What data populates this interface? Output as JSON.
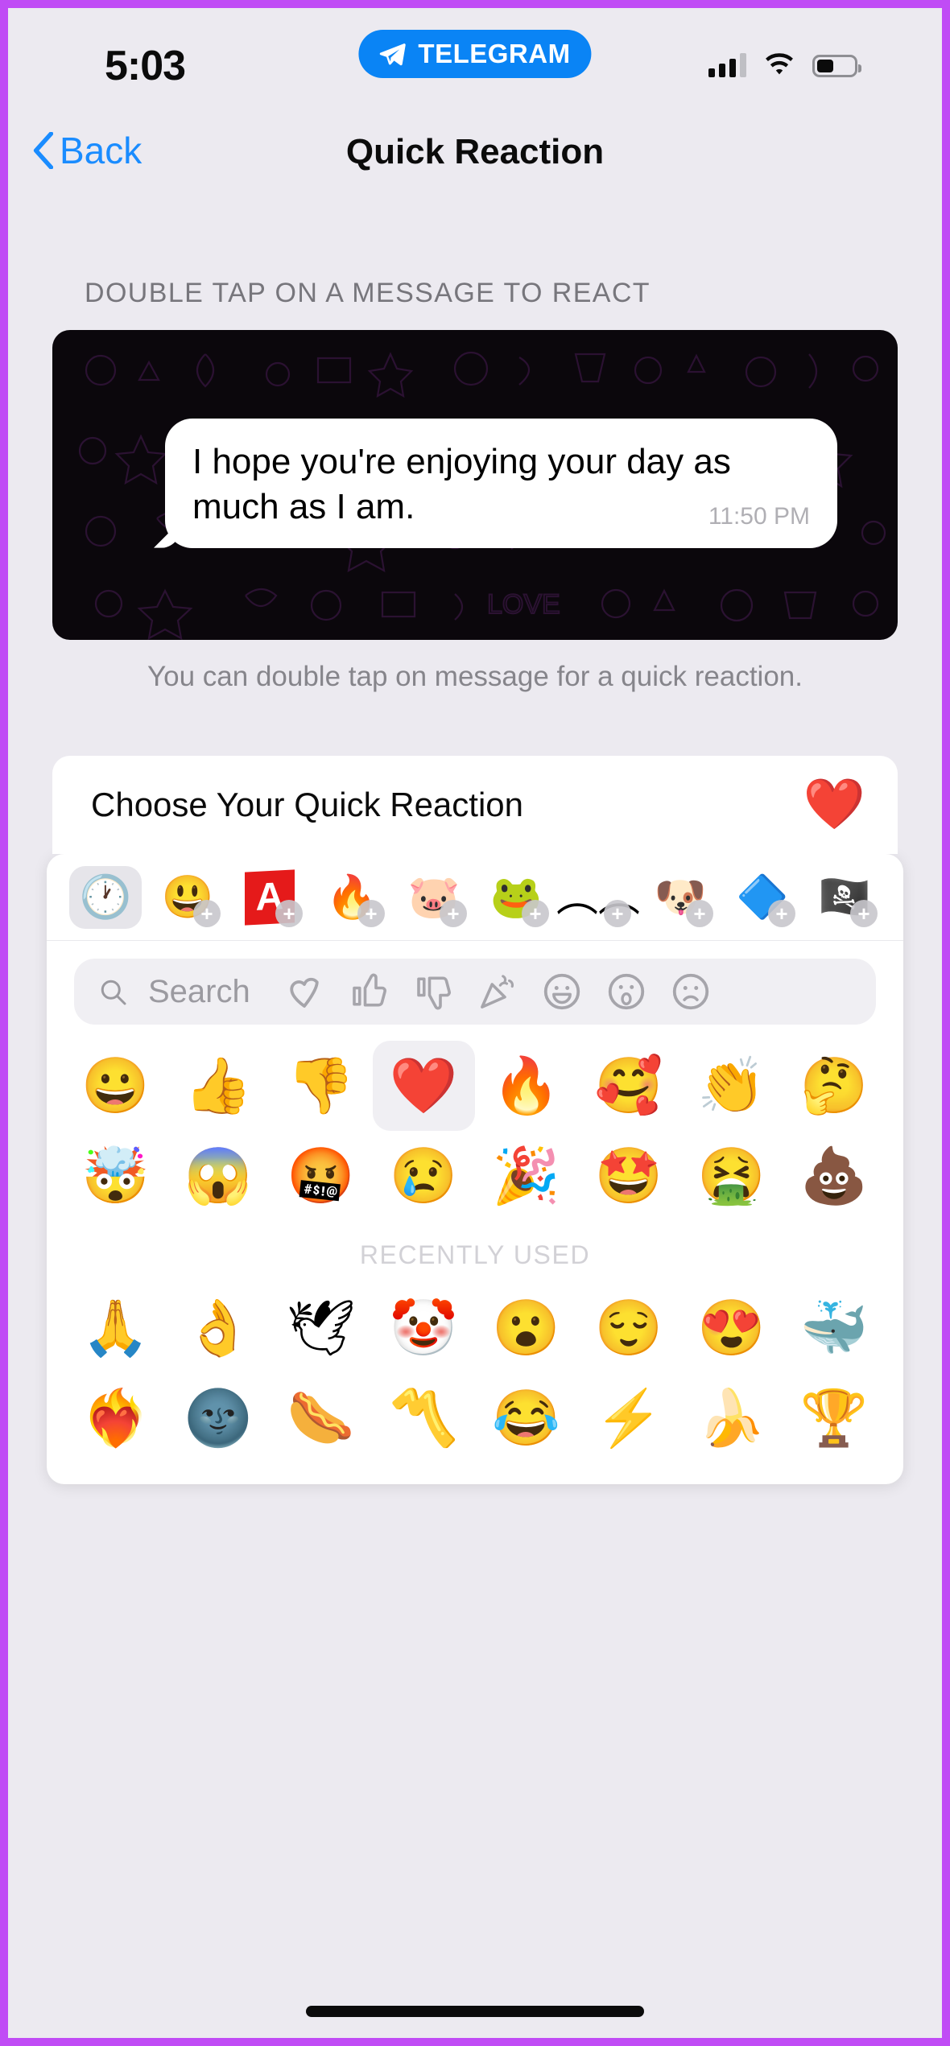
{
  "theme": {
    "accent_blue": "#1a8cff",
    "telegram_blue": "#0a84f5",
    "page_bg": "#eceaf0",
    "card_bg": "#ffffff",
    "border_purple": "#c04cf5"
  },
  "status_bar": {
    "time": "5:03",
    "badge_label": "TELEGRAM",
    "badge_icon": "telegram-plane-icon",
    "signal_icon": "cellular-signal-icon",
    "signal_bars_filled": 3,
    "signal_bars_total": 4,
    "wifi_icon": "wifi-icon",
    "battery_icon": "battery-icon",
    "battery_percent": 45
  },
  "nav_bar": {
    "back_icon": "chevron-left-icon",
    "back_label": "Back",
    "title": "Quick Reaction"
  },
  "section": {
    "header": "DOUBLE TAP ON A MESSAGE TO REACT",
    "footnote": "You can double tap on message for a quick reaction."
  },
  "chat_preview": {
    "message_text": "I hope you're enjoying your day as much as I am.",
    "timestamp": "11:50 PM"
  },
  "choose_row": {
    "label": "Choose Your Quick Reaction",
    "selected_emoji": "❤️",
    "selected_emoji_name": "red-heart"
  },
  "picker": {
    "packs": [
      {
        "name": "recent-clock",
        "glyph": "🕐",
        "has_add": false,
        "active": true
      },
      {
        "name": "smiley-sticker-pack",
        "glyph": "😃",
        "has_add": true,
        "active": false
      },
      {
        "name": "letter-a-sticker-pack",
        "glyph": "A",
        "has_add": true,
        "active": false,
        "style": "red-a"
      },
      {
        "name": "fire-face-sticker-pack",
        "glyph": "🔥",
        "has_add": true,
        "active": false
      },
      {
        "name": "pink-bear-sticker-pack",
        "glyph": "🐷",
        "has_add": true,
        "active": false
      },
      {
        "name": "green-frog-sticker-pack",
        "glyph": "🐸",
        "has_add": true,
        "active": false
      },
      {
        "name": "eyebrows-sticker-pack",
        "glyph": "︵︵",
        "has_add": true,
        "active": false
      },
      {
        "name": "shiba-dog-sticker-pack",
        "glyph": "🐶",
        "has_add": true,
        "active": false
      },
      {
        "name": "purple-diamond-sticker-pack",
        "glyph": "🔷",
        "has_add": true,
        "active": false
      },
      {
        "name": "pirate-flag-sticker-pack",
        "glyph": "🏴‍☠️",
        "has_add": true,
        "active": false
      }
    ],
    "search": {
      "icon": "search-icon",
      "placeholder": "Search",
      "value": ""
    },
    "quick_filters": [
      {
        "name": "heart-outline-filter",
        "glyph": "heart"
      },
      {
        "name": "thumbs-up-outline-filter",
        "glyph": "thumbup"
      },
      {
        "name": "thumbs-down-outline-filter",
        "glyph": "thumbdown"
      },
      {
        "name": "party-popper-outline-filter",
        "glyph": "party"
      },
      {
        "name": "smiley-outline-filter",
        "glyph": "smile"
      },
      {
        "name": "surprised-outline-filter",
        "glyph": "surprise"
      },
      {
        "name": "sad-outline-filter",
        "glyph": "sad"
      }
    ],
    "main_emojis": [
      {
        "name": "grinning-face",
        "glyph": "😀",
        "selected": false
      },
      {
        "name": "thumbs-up",
        "glyph": "👍",
        "selected": false
      },
      {
        "name": "thumbs-down",
        "glyph": "👎",
        "selected": false
      },
      {
        "name": "red-heart",
        "glyph": "❤️",
        "selected": true
      },
      {
        "name": "fire",
        "glyph": "🔥",
        "selected": false
      },
      {
        "name": "smiling-face-with-hearts",
        "glyph": "🥰",
        "selected": false
      },
      {
        "name": "clapping-hands",
        "glyph": "👏",
        "selected": false
      },
      {
        "name": "thinking-face",
        "glyph": "🤔",
        "selected": false
      },
      {
        "name": "exploding-head",
        "glyph": "🤯",
        "selected": false
      },
      {
        "name": "face-screaming-in-fear",
        "glyph": "😱",
        "selected": false
      },
      {
        "name": "face-with-symbols-on-mouth",
        "glyph": "🤬",
        "selected": false
      },
      {
        "name": "disappointed-face",
        "glyph": "😢",
        "selected": false
      },
      {
        "name": "party-popper",
        "glyph": "🎉",
        "selected": false
      },
      {
        "name": "star-struck",
        "glyph": "🤩",
        "selected": false
      },
      {
        "name": "face-vomiting",
        "glyph": "🤮",
        "selected": false
      },
      {
        "name": "pile-of-poo",
        "glyph": "💩",
        "selected": false
      }
    ],
    "recent_label": "RECENTLY USED",
    "recent_emojis": [
      {
        "name": "folded-hands",
        "glyph": "🙏"
      },
      {
        "name": "ok-hand",
        "glyph": "👌"
      },
      {
        "name": "dove",
        "glyph": "🕊"
      },
      {
        "name": "clown-face",
        "glyph": "🤡"
      },
      {
        "name": "face-with-open-mouth",
        "glyph": "😮"
      },
      {
        "name": "relieved-face",
        "glyph": "😌"
      },
      {
        "name": "smiling-face-with-heart-eyes",
        "glyph": "😍"
      },
      {
        "name": "whale",
        "glyph": "🐳"
      },
      {
        "name": "heart-on-fire",
        "glyph": "❤️‍🔥"
      },
      {
        "name": "new-moon-face",
        "glyph": "🌚"
      },
      {
        "name": "hot-dog",
        "glyph": "🌭"
      },
      {
        "name": "scribble-mark",
        "glyph": "〽️"
      },
      {
        "name": "face-with-tears-of-joy",
        "glyph": "😂"
      },
      {
        "name": "high-voltage",
        "glyph": "⚡"
      },
      {
        "name": "banana",
        "glyph": "🍌"
      },
      {
        "name": "trophy",
        "glyph": "🏆"
      }
    ]
  },
  "home_indicator": {
    "name": "home-indicator"
  }
}
